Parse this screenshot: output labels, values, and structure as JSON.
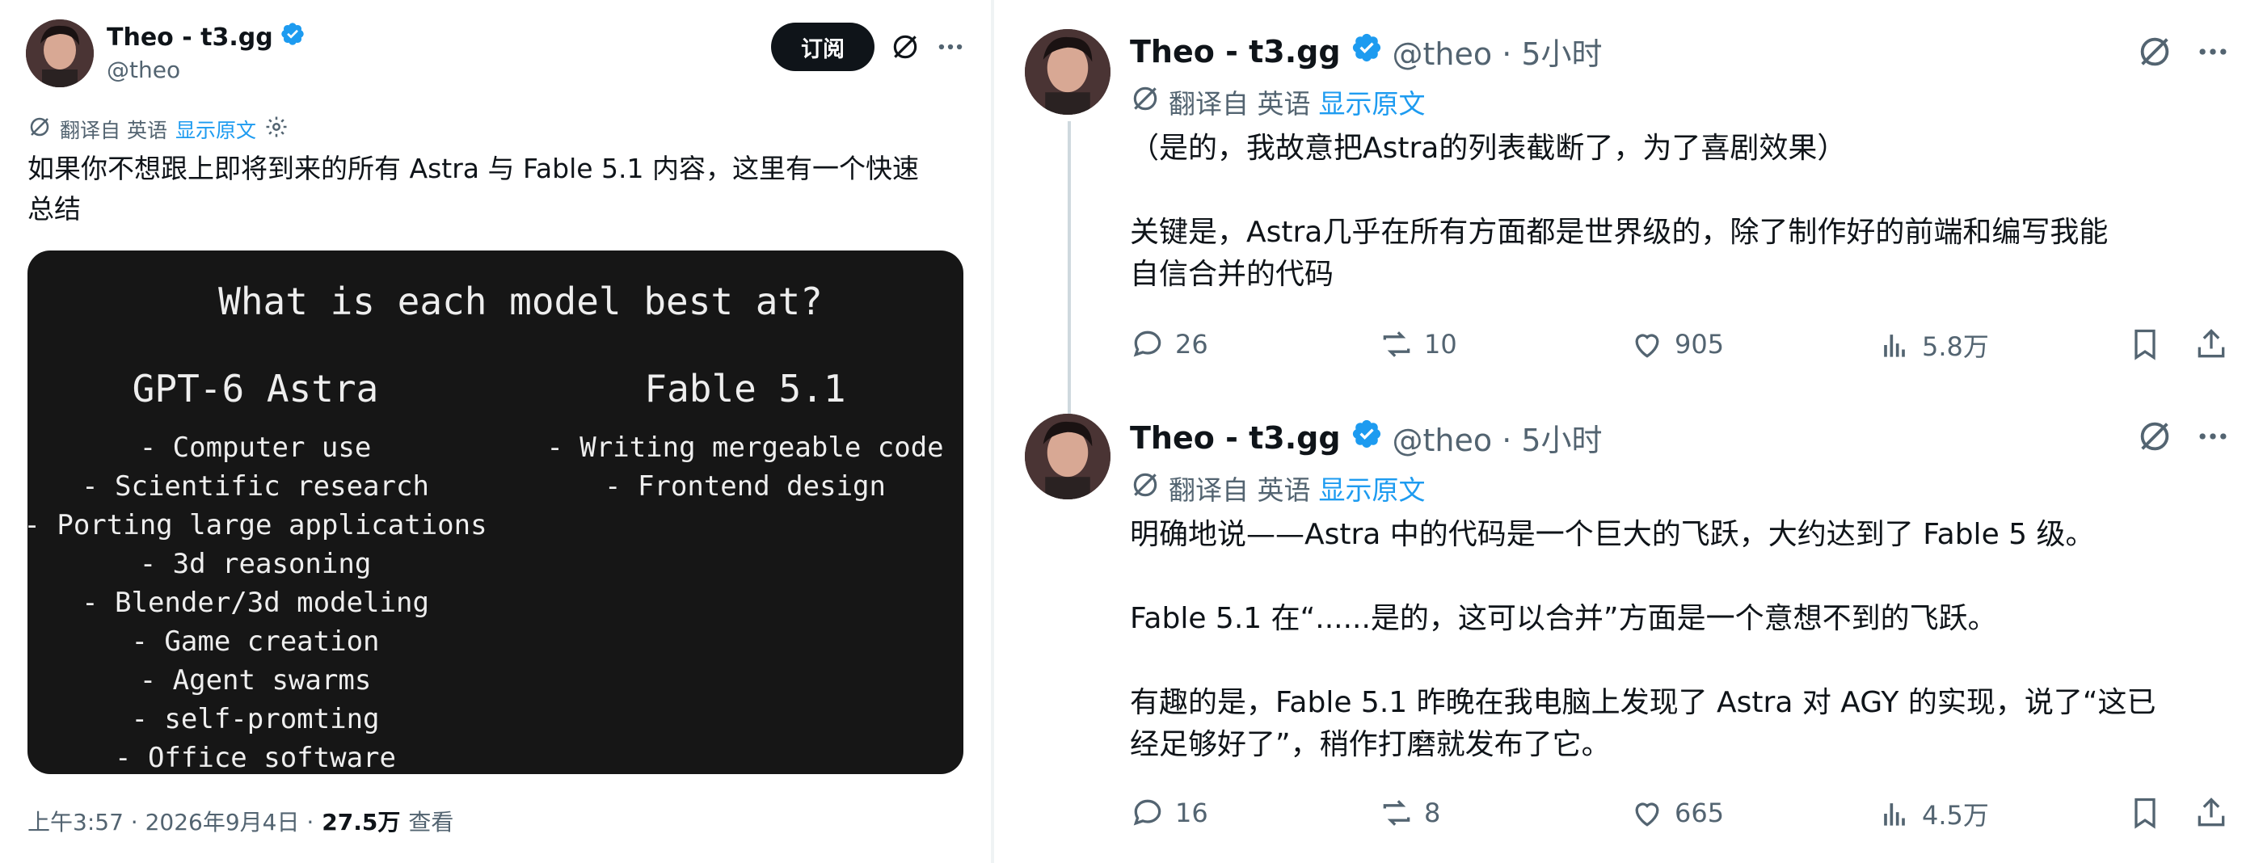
{
  "left_tweet": {
    "author_name": "Theo - t3.gg",
    "author_handle": "@theo",
    "subscribe_label": "订阅",
    "translate": {
      "label": "翻译自 英语",
      "show_original": "显示原文"
    },
    "body_line1": "如果你不想跟上即将到来的所有 Astra 与 Fable 5.1 内容，这里有一个快速",
    "body_line2": "总结",
    "image": {
      "title": "What is each model best at?",
      "col_left_title": "GPT-6 Astra",
      "col_left_items": [
        "- Computer use",
        "- Scientific research",
        "- Porting large applications",
        "- 3d reasoning",
        "- Blender/3d modeling",
        "- Game creation",
        "- Agent swarms",
        "- self-promting",
        "- Office software"
      ],
      "col_right_title": "Fable 5.1",
      "col_right_items": [
        "- Writing mergeable code",
        "- Frontend design"
      ]
    },
    "footer": {
      "timestamp": "上午3:57 · 2026年9月4日 ·",
      "views": "27.5万",
      "views_label": "查看"
    }
  },
  "right_tweets": [
    {
      "author_name": "Theo - t3.gg",
      "handle_time": "@theo · 5小时",
      "translate_label": "翻译自 英语",
      "show_original": "显示原文",
      "paragraphs": [
        "（是的，我故意把Astra的列表截断了，为了喜剧效果）",
        "关键是，Astra几乎在所有方面都是世界级的，除了制作好的前端和编写我能",
        "自信合并的代码"
      ],
      "stats": {
        "replies": "26",
        "reposts": "10",
        "likes": "905",
        "views": "5.8万"
      }
    },
    {
      "author_name": "Theo - t3.gg",
      "handle_time": "@theo · 5小时",
      "translate_label": "翻译自 英语",
      "show_original": "显示原文",
      "paragraphs": [
        "明确地说——Astra 中的代码是一个巨大的飞跃，大约达到了 Fable 5 级。",
        "Fable 5.1 在“......是的，这可以合并”方面是一个意想不到的飞跃。",
        "有趣的是，Fable 5.1 昨晚在我电脑上发现了 Astra 对 AGY 的实现，说了“这已",
        "经足够好了”，稍作打磨就发布了它。"
      ],
      "stats": {
        "replies": "16",
        "reposts": "8",
        "likes": "665",
        "views": "4.5万"
      }
    }
  ],
  "colors": {
    "text": "#0f1419",
    "muted": "#536471",
    "link": "#1d9bf0",
    "verified": "#1d9bf0",
    "card_bg": "#161616"
  },
  "icons": [
    "verified-badge-icon",
    "grok-icon",
    "more-icon",
    "translate-icon",
    "settings-icon",
    "reply-icon",
    "repost-icon",
    "like-icon",
    "views-icon",
    "bookmark-icon",
    "share-icon"
  ]
}
